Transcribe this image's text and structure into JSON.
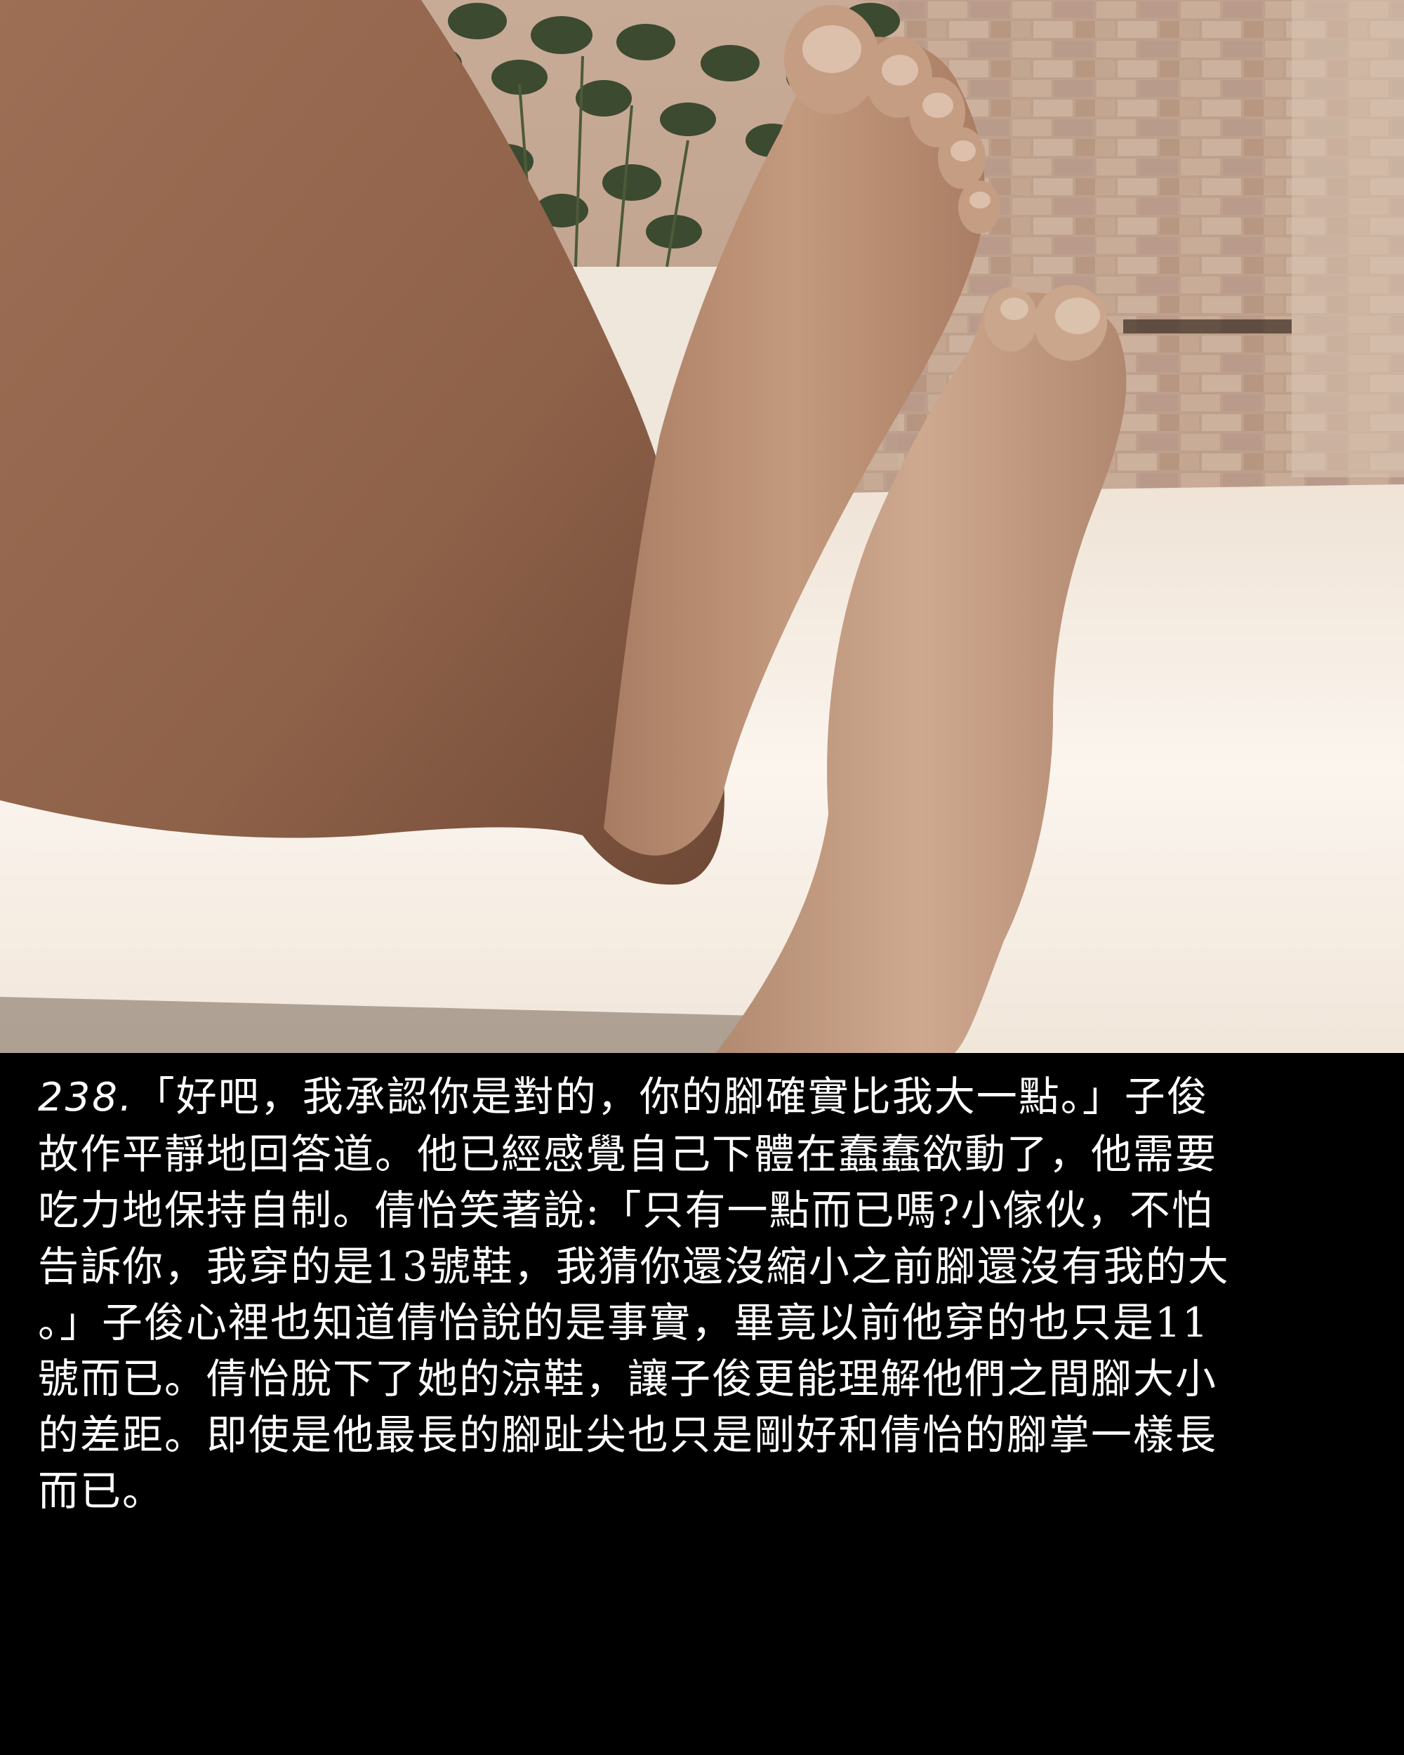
{
  "panel": {
    "number": "238.",
    "lines": [
      "「好吧，我承認你是對的，你的腳確實比我大一點。」子俊",
      "故作平靜地回答道。他已經感覺自己下體在蠢蠢欲動了，他需要",
      "吃力地保持自制。倩怡笑著說:「只有一點而已嗎?小傢伙，不怕",
      "告訴你，我穿的是13號鞋，我猜你還沒縮小之前腳還沒有我的大",
      "。」子俊心裡也知道倩怡說的是事實，畢竟以前他穿的也只是11",
      "號而已。倩怡脫下了她的涼鞋，讓子俊更能理解他們之間腳大小",
      "的差距。即使是他最長的腳趾尖也只是剛好和倩怡的腳掌一樣長",
      "而已。"
    ]
  },
  "colors": {
    "caption_background": "#000000",
    "caption_text": "#ffffff",
    "skin": "#b98e72",
    "brick": "#b89a86",
    "table": "#f4ece2"
  }
}
